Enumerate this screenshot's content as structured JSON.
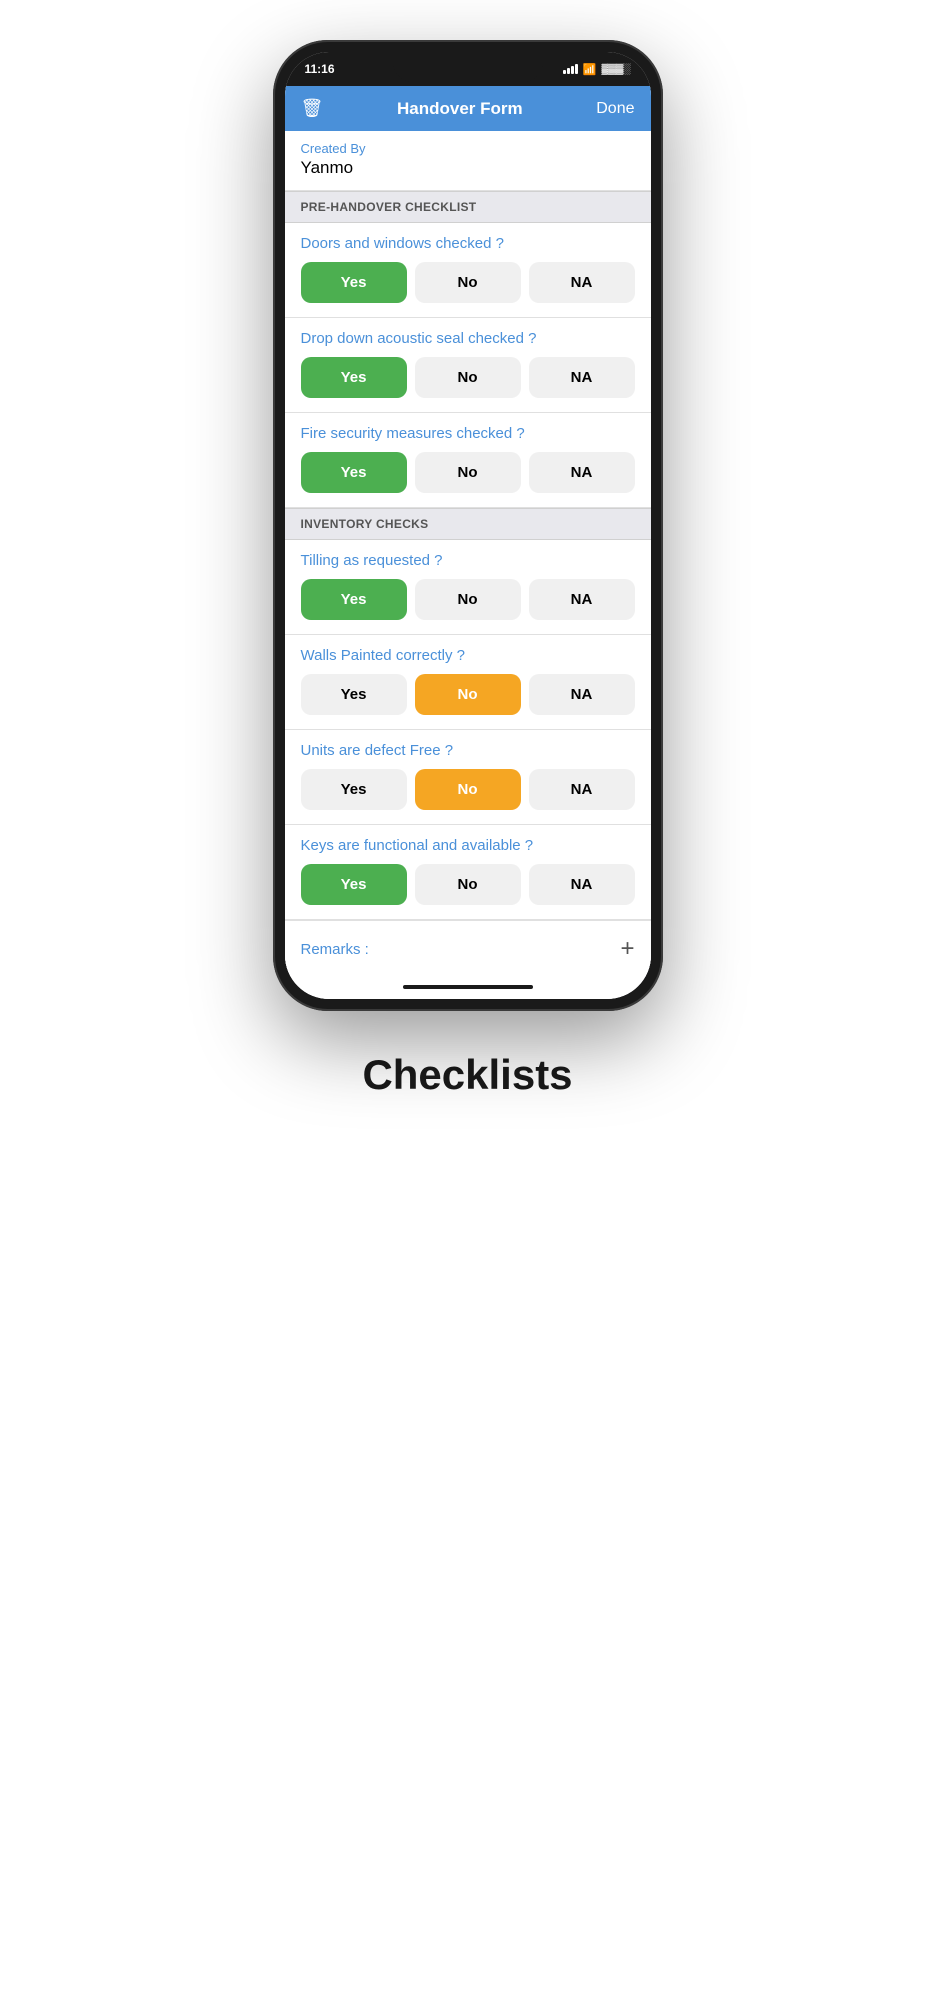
{
  "status_bar": {
    "time": "11:16",
    "battery": "▓▓▓▓░"
  },
  "header": {
    "title": "Handover Form",
    "done_label": "Done",
    "trash_icon": "🗑"
  },
  "created_by": {
    "label": "Created By",
    "value": "Yanmo"
  },
  "sections": [
    {
      "id": "pre-handover",
      "label": "PRE-HANDOVER CHECKLIST",
      "items": [
        {
          "id": "doors-windows",
          "question": "Doors and windows checked ?",
          "selected": "yes"
        },
        {
          "id": "acoustic-seal",
          "question": "Drop down acoustic seal checked ?",
          "selected": "yes"
        },
        {
          "id": "fire-security",
          "question": "Fire security measures checked ?",
          "selected": "yes"
        }
      ]
    },
    {
      "id": "inventory-checks",
      "label": "INVENTORY CHECKS",
      "items": [
        {
          "id": "tilling",
          "question": "Tilling as requested ?",
          "selected": "yes"
        },
        {
          "id": "walls-painted",
          "question": "Walls Painted correctly ?",
          "selected": "no"
        },
        {
          "id": "units-defect",
          "question": "Units are defect Free ?",
          "selected": "no"
        },
        {
          "id": "keys",
          "question": "Keys are functional and available ?",
          "selected": "yes"
        }
      ]
    }
  ],
  "buttons": {
    "yes": "Yes",
    "no": "No",
    "na": "NA"
  },
  "remarks": {
    "label": "Remarks :",
    "plus_icon": "+"
  },
  "bottom_label": "Checklists"
}
